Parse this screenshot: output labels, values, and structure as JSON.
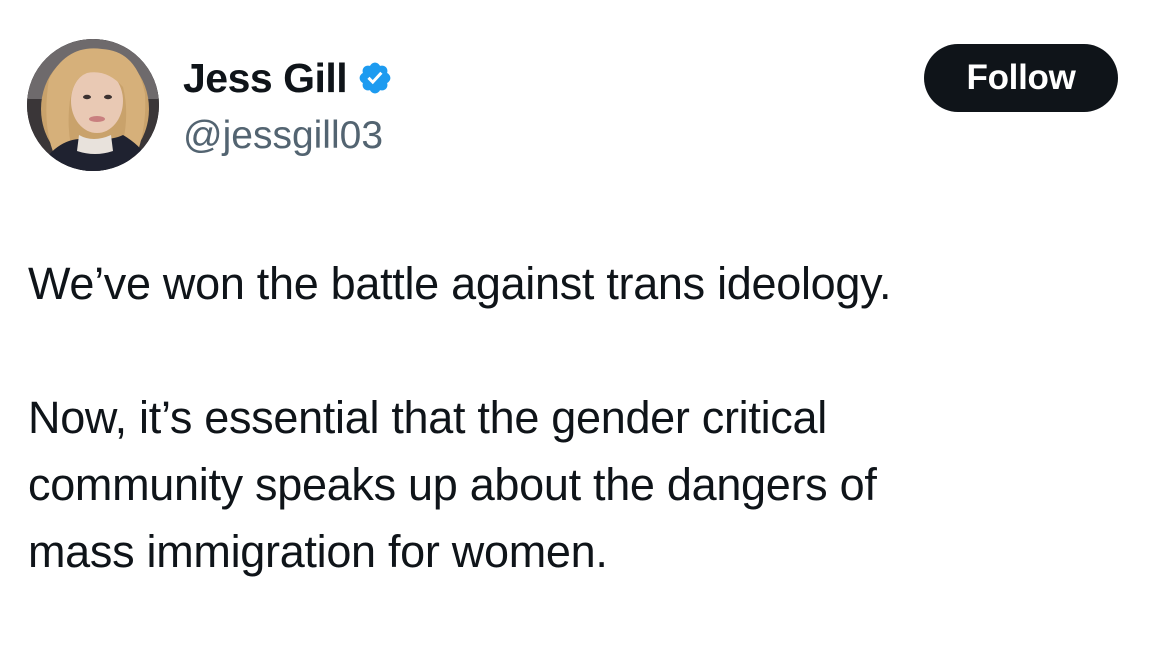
{
  "author": {
    "display_name": "Jess Gill",
    "handle": "@jessgill03",
    "verified": true,
    "verified_badge_color": "#1d9bf0"
  },
  "follow_button": {
    "label": "Follow",
    "background": "#0f1419",
    "text_color": "#ffffff"
  },
  "tweet": {
    "paragraphs": [
      "We’ve won the battle against trans ideology.",
      "Now, it’s essential that the gender critical\ncommunity speaks up about the dangers of\nmass immigration for women."
    ]
  },
  "icons": {
    "verified": "verified-badge-icon"
  }
}
